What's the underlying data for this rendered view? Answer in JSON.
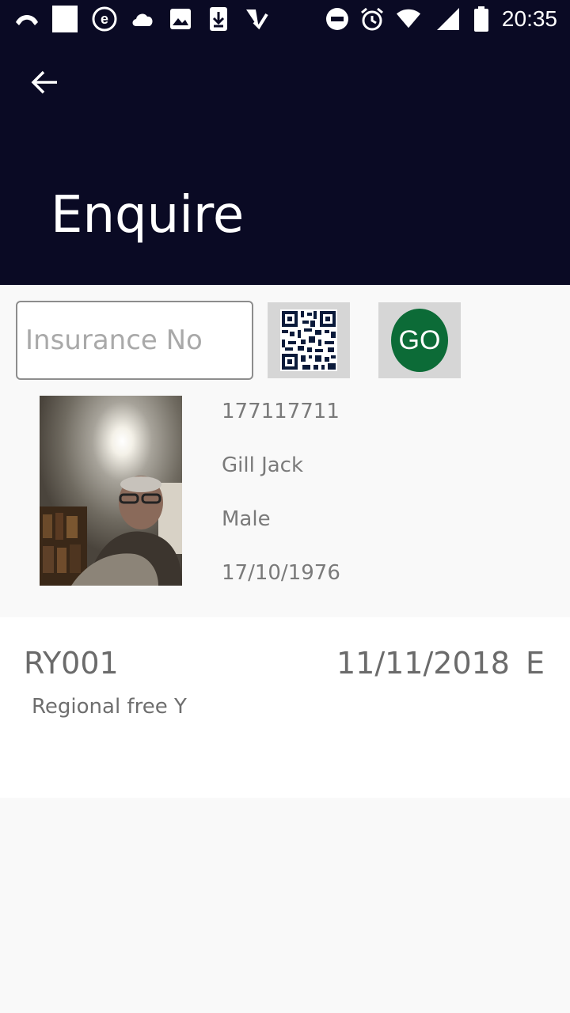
{
  "status_bar": {
    "time": "20:35",
    "icons": [
      "missed-call-icon",
      "white-square-icon",
      "e-app-icon",
      "cloud-icon",
      "image-icon",
      "download-icon",
      "checkmark-app-icon",
      "do-not-disturb-icon",
      "alarm-icon",
      "wifi-icon",
      "signal-icon",
      "battery-icon"
    ]
  },
  "app_bar": {
    "title": "Enquire",
    "back_icon": "arrow-back-icon"
  },
  "search": {
    "placeholder": "Insurance No",
    "value": "",
    "qr_icon": "qr-code-icon",
    "go_label": "GO",
    "go_color": "#0c6b37"
  },
  "person": {
    "insurance_no": "177117711",
    "name": "Gill Jack",
    "gender": "Male",
    "dob": "17/10/1976"
  },
  "policy": {
    "code": "RY001",
    "date": "11/11/2018",
    "status": "E",
    "description": "Regional free Y"
  },
  "colors": {
    "header_bg": "#0a0a24",
    "go_green": "#0c6b37"
  }
}
